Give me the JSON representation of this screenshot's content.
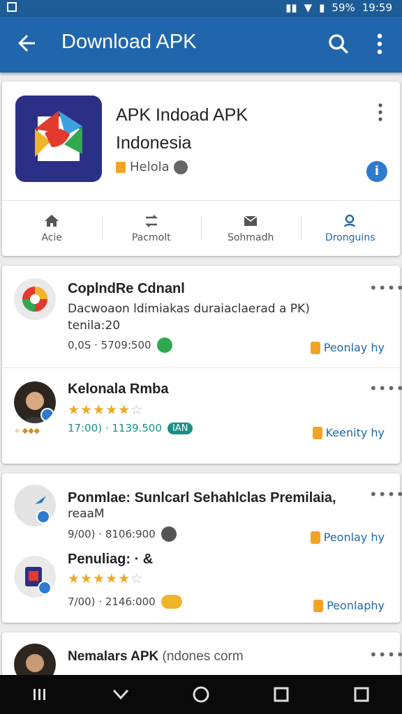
{
  "status_bar": {
    "time": "19:59",
    "battery": "59%"
  },
  "app_bar": {
    "title": "Download APK"
  },
  "hero": {
    "title_line1": "APK Indoad APK",
    "title_line2": "Indonesia",
    "developer": "Helola"
  },
  "actions": [
    {
      "label": "Acie",
      "icon": "home-icon"
    },
    {
      "label": "Pacmolt",
      "icon": "transfer-icon"
    },
    {
      "label": "Sohmadh",
      "icon": "mail-icon"
    },
    {
      "label": "Dronguins",
      "icon": "person-search-icon",
      "active": true
    }
  ],
  "list1": [
    {
      "name": "CoplndRe Cdnanl",
      "desc": "Dacwoaon ldimiakas duraiaclaerad a PK)",
      "desc2": "tenila:20",
      "meta": "0,0S · 5709:500",
      "cta": "Peonlay hy",
      "more": "••••"
    },
    {
      "name": "Kelonala Rmba",
      "rating": "4",
      "meta": "17:00) · 1139.500",
      "tag": "IAN",
      "cta": "Keenity hy",
      "more": "••••"
    }
  ],
  "list2": [
    {
      "name": "Ponmlae: Sunlcarl Sehahlclas Premilaia,",
      "desc": "reaaM",
      "meta": "9/00) · 8106:900",
      "cta": "Peonlay hy",
      "more": "••••"
    },
    {
      "name": "Penuliag: · &",
      "rating": "4",
      "meta": "7/00) · 2146:000",
      "cta": "Peonlaphy"
    }
  ],
  "list3": [
    {
      "name": "Nemalars APK",
      "name_suffix": "(ndones corm",
      "more": "••••"
    }
  ],
  "colors": {
    "primary": "#2166ad",
    "accent": "#f2a326",
    "link": "#1c68a8"
  }
}
